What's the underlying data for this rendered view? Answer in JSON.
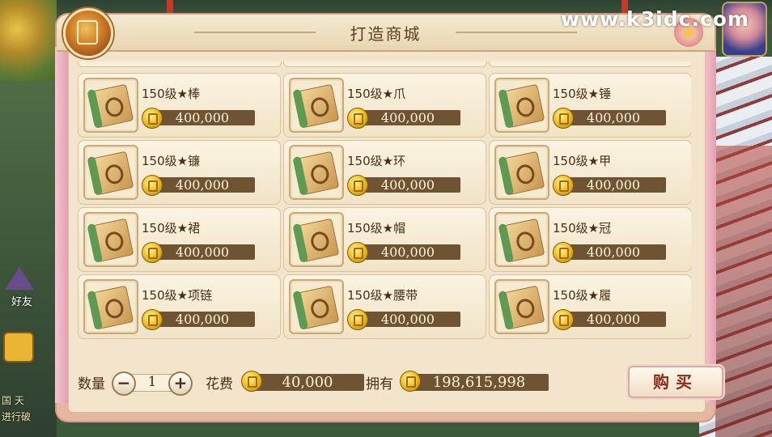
{
  "watermark": "www.k3idc.com",
  "background": {
    "side_texts": [
      "国 天",
      "进行破"
    ],
    "friend_label": "好友"
  },
  "dialog": {
    "title": "打造商城",
    "items": [
      {
        "name": "150级★棒",
        "price": "400,000"
      },
      {
        "name": "150级★爪",
        "price": "400,000"
      },
      {
        "name": "150级★锤",
        "price": "400,000"
      },
      {
        "name": "150级★镰",
        "price": "400,000"
      },
      {
        "name": "150级★环",
        "price": "400,000"
      },
      {
        "name": "150级★甲",
        "price": "400,000"
      },
      {
        "name": "150级★裙",
        "price": "400,000"
      },
      {
        "name": "150级★帽",
        "price": "400,000"
      },
      {
        "name": "150级★冠",
        "price": "400,000"
      },
      {
        "name": "150级★项链",
        "price": "400,000"
      },
      {
        "name": "150级★腰带",
        "price": "400,000"
      },
      {
        "name": "150级★履",
        "price": "400,000"
      }
    ],
    "footer": {
      "quantity_label": "数量",
      "quantity": "1",
      "minus": "−",
      "plus": "+",
      "cost_label": "花费",
      "cost": "40,000",
      "owned_label": "拥有",
      "owned": "198,615,998",
      "buy_label": "购买"
    }
  }
}
